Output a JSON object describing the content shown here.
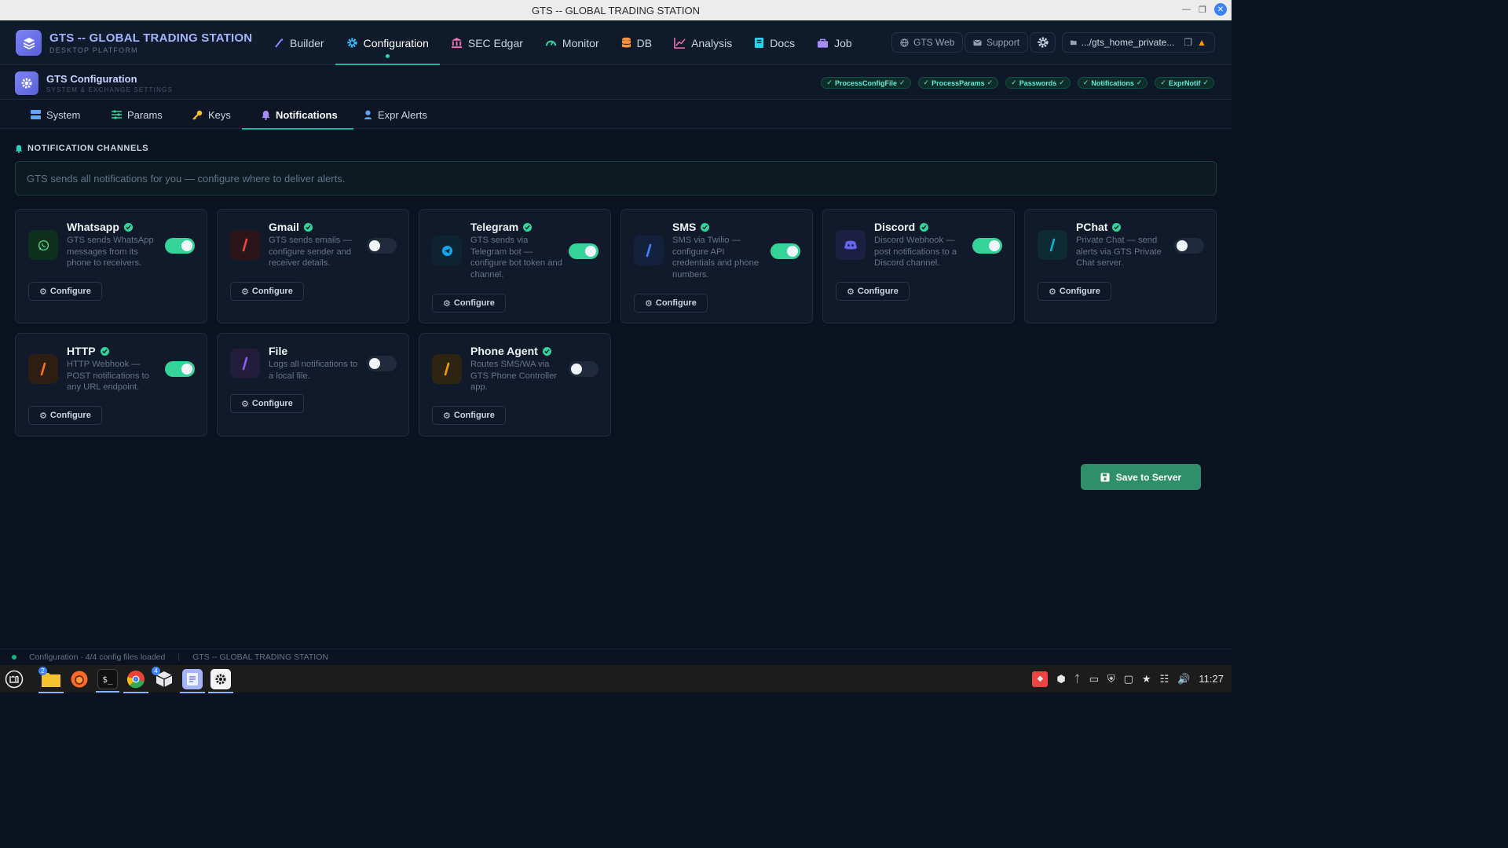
{
  "window": {
    "title": "GTS -- GLOBAL TRADING STATION"
  },
  "brand": {
    "title": "GTS -- GLOBAL TRADING STATION",
    "subtitle": "DESKTOP PLATFORM"
  },
  "nav": {
    "tabs": [
      {
        "label": "Builder"
      },
      {
        "label": "Configuration"
      },
      {
        "label": "SEC Edgar"
      },
      {
        "label": "Monitor"
      },
      {
        "label": "DB"
      },
      {
        "label": "Analysis"
      },
      {
        "label": "Docs"
      },
      {
        "label": "Job"
      }
    ],
    "gts_web": "GTS Web",
    "support": "Support",
    "path": ".../gts_home_private..."
  },
  "config_header": {
    "title": "GTS Configuration",
    "subtitle": "SYSTEM & EXCHANGE SETTINGS",
    "badges": [
      "ProcessConfigFile",
      "ProcessParams",
      "Passwords",
      "Notifications",
      "ExprNotif"
    ]
  },
  "subtabs": [
    "System",
    "Params",
    "Keys",
    "Notifications",
    "Expr Alerts"
  ],
  "section": {
    "title": "NOTIFICATION CHANNELS",
    "info": "GTS sends all notifications for you — configure where to deliver alerts."
  },
  "configure_label": "Configure",
  "channels": [
    {
      "name": "Whatsapp",
      "desc": "GTS sends WhatsApp messages from its phone to receivers.",
      "enabled": true,
      "verified": true,
      "color": "#22c55e"
    },
    {
      "name": "Gmail",
      "desc": "GTS sends emails — configure sender and receiver details.",
      "enabled": false,
      "verified": true,
      "color": "#ef4444"
    },
    {
      "name": "Telegram",
      "desc": "GTS sends via Telegram bot — configure bot token and channel.",
      "enabled": true,
      "verified": true,
      "color": "#0ea5e9"
    },
    {
      "name": "SMS",
      "desc": "SMS via Twilio — configure API credentials and phone numbers.",
      "enabled": true,
      "verified": true,
      "color": "#3b82f6"
    },
    {
      "name": "Discord",
      "desc": "Discord Webhook — post notifications to a Discord channel.",
      "enabled": true,
      "verified": true,
      "color": "#6366f1"
    },
    {
      "name": "PChat",
      "desc": "Private Chat — send alerts via GTS Private Chat server.",
      "enabled": false,
      "verified": true,
      "color": "#06b6d4"
    },
    {
      "name": "HTTP",
      "desc": "HTTP Webhook — POST notifications to any URL endpoint.",
      "enabled": true,
      "verified": true,
      "color": "#f97316"
    },
    {
      "name": "File",
      "desc": "Logs all notifications to a local file.",
      "enabled": false,
      "verified": false,
      "color": "#8b5cf6"
    },
    {
      "name": "Phone Agent",
      "desc": "Routes SMS/WA via GTS Phone Controller app.",
      "enabled": false,
      "verified": true,
      "color": "#f59e0b"
    }
  ],
  "save_label": "Save to Server",
  "status": {
    "left": "Configuration · 4/4 config files loaded",
    "right": "GTS -- GLOBAL TRADING STATION"
  },
  "taskbar": {
    "clock": "11:27",
    "badge_files": "2",
    "badge_app": "4"
  }
}
